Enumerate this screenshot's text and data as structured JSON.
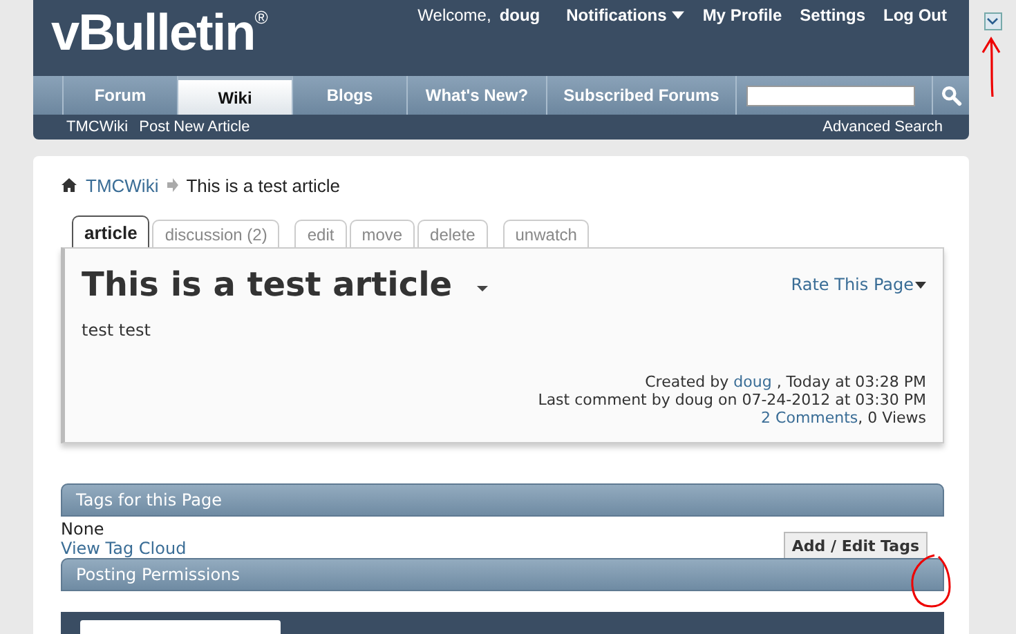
{
  "header": {
    "logo": "vBulletin",
    "logo_mark": "®",
    "welcome": "Welcome,",
    "user": "doug",
    "links": [
      {
        "label": "Notifications",
        "kind": "menu"
      },
      {
        "label": "My Profile",
        "kind": "link"
      },
      {
        "label": "Settings",
        "kind": "link"
      },
      {
        "label": "Log Out",
        "kind": "link"
      }
    ]
  },
  "nav_tabs": [
    {
      "label": "Forum",
      "selected": false
    },
    {
      "label": "Wiki",
      "selected": true
    },
    {
      "label": "Blogs",
      "selected": false
    },
    {
      "label": "What's New?",
      "selected": false
    },
    {
      "label": "Subscribed Forums",
      "selected": false
    }
  ],
  "sub_nav": {
    "links": [
      "TMCWiki",
      "Post New Article"
    ],
    "advanced_search": "Advanced Search"
  },
  "breadcrumb": {
    "parent": "TMCWiki",
    "current": "This is a test article"
  },
  "article_tab_groups": [
    [
      {
        "label": "article",
        "selected": true
      },
      {
        "label": "discussion (2)",
        "selected": false
      }
    ],
    [
      {
        "label": "edit",
        "selected": false
      },
      {
        "label": "move",
        "selected": false
      },
      {
        "label": "delete",
        "selected": false
      }
    ],
    [
      {
        "label": "unwatch",
        "selected": false
      }
    ]
  ],
  "article": {
    "title": "This is a test article",
    "rate": "Rate This Page",
    "body": "test test",
    "created_prefix": "Created by",
    "created_user": "doug",
    "created_suffix": ", Today at 03:28 PM",
    "last_comment": "Last comment by doug on 07-24-2012 at 03:30 PM",
    "comments_link": "2 Comments",
    "views": ", 0 Views"
  },
  "tags": {
    "heading": "Tags for this Page",
    "value": "None",
    "cloud_link": "View Tag Cloud",
    "button": "Add / Edit Tags"
  },
  "permissions": {
    "heading": "Posting Permissions"
  }
}
